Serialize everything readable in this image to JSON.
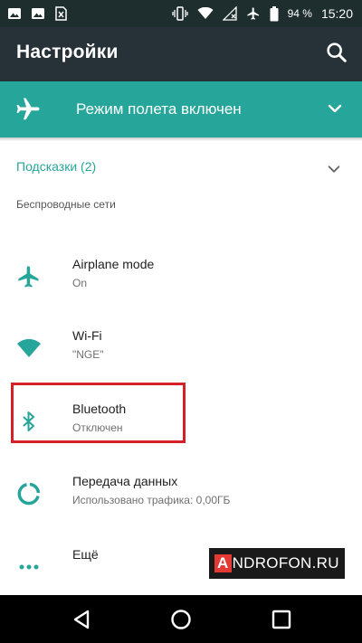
{
  "status_bar": {
    "battery": "94 %",
    "time": "15:20",
    "icons": [
      "image-icon",
      "image-icon",
      "sim-card-icon",
      "vibrate-icon",
      "wifi-icon",
      "no-signal-icon",
      "airplane-icon",
      "battery-icon"
    ]
  },
  "app_bar": {
    "title": "Настройки",
    "search_icon": "search-icon"
  },
  "airplane_banner": {
    "text": "Режим полета включен",
    "icon": "airplane-icon",
    "expand_icon": "chevron-down-icon"
  },
  "hints": {
    "label": "Подсказки (2)",
    "expand_icon": "chevron-down-icon"
  },
  "section": {
    "title": "Беспроводные сети"
  },
  "items": [
    {
      "title": "Airplane mode",
      "subtitle": "On",
      "icon": "airplane-icon"
    },
    {
      "title": "Wi-Fi",
      "subtitle": "\"NGE\"",
      "icon": "wifi-icon"
    },
    {
      "title": "Bluetooth",
      "subtitle": "Отключен",
      "icon": "bluetooth-icon"
    },
    {
      "title": "Передача данных",
      "subtitle": "Использовано трафика: 0,00ГБ",
      "icon": "data-usage-icon"
    },
    {
      "title": "Ещё",
      "subtitle": "",
      "icon": "more-icon"
    }
  ],
  "watermark": {
    "first_letter": "A",
    "rest": "NDROFON.RU"
  },
  "nav_bar": {
    "icons": [
      "back-icon",
      "home-icon",
      "recents-icon"
    ]
  },
  "colors": {
    "status_bar": "#1e2e2e",
    "app_bar": "#263238",
    "accent": "#26a69a",
    "highlight": "#d42027"
  }
}
